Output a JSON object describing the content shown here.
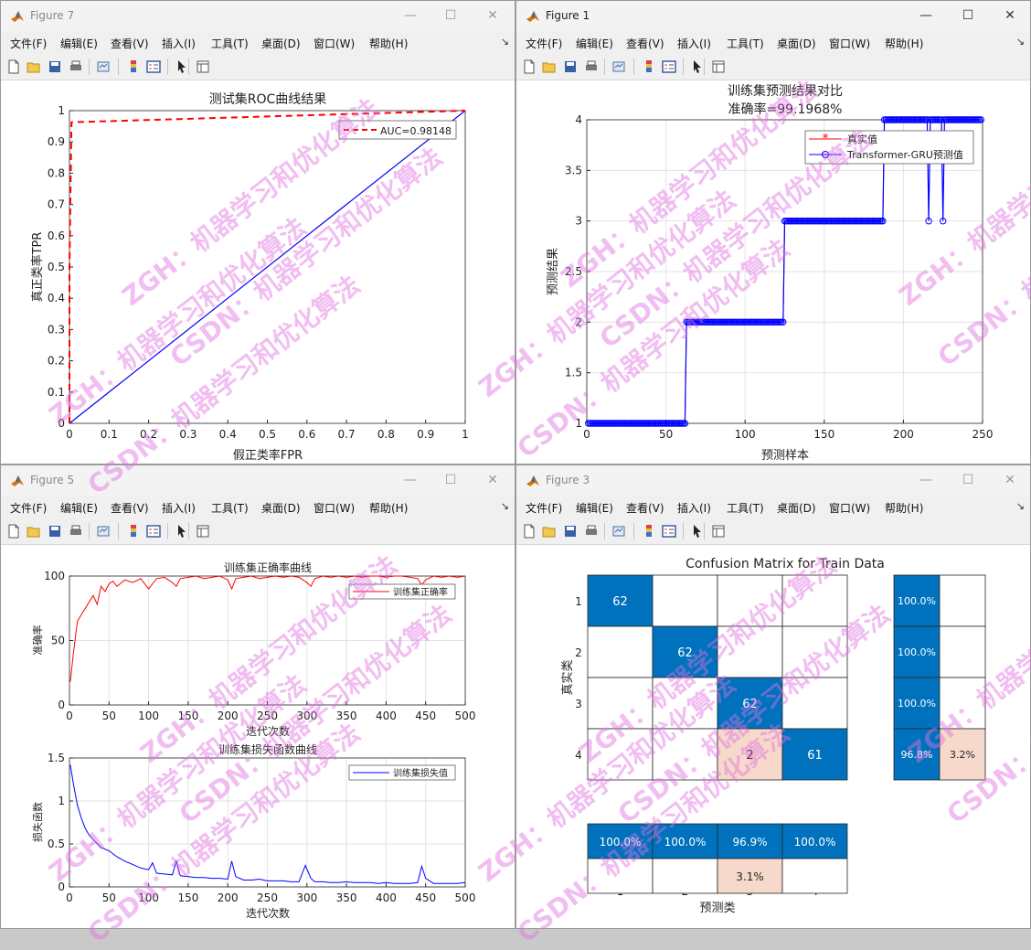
{
  "colors": {
    "red": "#ff0000",
    "blue": "#0000ff",
    "matrix_blue": "#0072bd",
    "matrix_peach": "#f6d9ca"
  },
  "menus": [
    "文件(F)",
    "编辑(E)",
    "查看(V)",
    "插入(I)",
    "工具(T)",
    "桌面(D)",
    "窗口(W)",
    "帮助(H)"
  ],
  "toolbar_icons": [
    "new-file-icon",
    "open-folder-icon",
    "save-icon",
    "print-icon",
    "link-icon",
    "colorbar-icon",
    "legend-icon",
    "pointer-icon",
    "property-inspector-icon"
  ],
  "watermarks": [
    "ZGH：机器学习和优化算法",
    "CSDN：机器学习和优化算法"
  ],
  "windows": {
    "fig7": {
      "title": "Figure 7"
    },
    "fig1": {
      "title": "Figure 1"
    },
    "fig5": {
      "title": "Figure 5"
    },
    "fig3": {
      "title": "Figure 3"
    }
  },
  "roc": {
    "title": "测试集ROC曲线结果",
    "xlabel": "假正类率FPR",
    "ylabel": "真正类率TPR",
    "legend": "AUC=0.98148",
    "xticks": [
      "0",
      "0.1",
      "0.2",
      "0.3",
      "0.4",
      "0.5",
      "0.6",
      "0.7",
      "0.8",
      "0.9",
      "1"
    ],
    "yticks": [
      "0",
      "0.1",
      "0.2",
      "0.3",
      "0.4",
      "0.5",
      "0.6",
      "0.7",
      "0.8",
      "0.9",
      "1"
    ]
  },
  "pred": {
    "title1": "训练集预测结果对比",
    "title2": "准确率=99.1968%",
    "xlabel": "预测样本",
    "ylabel": "预测结果",
    "legend_true": "真实值",
    "legend_pred": "Transformer-GRU预测值",
    "xticks": [
      "0",
      "50",
      "100",
      "150",
      "200",
      "250"
    ],
    "yticks": [
      "1",
      "1.5",
      "2",
      "2.5",
      "3",
      "3.5",
      "4"
    ]
  },
  "acc": {
    "title": "训练集正确率曲线",
    "xlabel": "迭代次数",
    "ylabel": "准确率",
    "legend": "训练集正确率",
    "xticks": [
      "0",
      "50",
      "100",
      "150",
      "200",
      "250",
      "300",
      "350",
      "400",
      "450",
      "500"
    ],
    "yticks": [
      "0",
      "50",
      "100"
    ]
  },
  "loss": {
    "title": "训练集损失函数曲线",
    "xlabel": "迭代次数",
    "ylabel": "损失函数",
    "legend": "训练集损失值",
    "xticks": [
      "0",
      "50",
      "100",
      "150",
      "200",
      "250",
      "300",
      "350",
      "400",
      "450",
      "500"
    ],
    "yticks": [
      "0",
      "0.5",
      "1",
      "1.5"
    ]
  },
  "cm": {
    "title": "Confusion Matrix for Train Data",
    "xlabel": "预测类",
    "ylabel": "真实类",
    "class_labels": [
      "1",
      "2",
      "3",
      "4"
    ],
    "row_summary": [
      [
        "100.0%",
        ""
      ],
      [
        "100.0%",
        ""
      ],
      [
        "100.0%",
        ""
      ],
      [
        "96.8%",
        "3.2%"
      ]
    ],
    "col_summary": [
      [
        "100.0%",
        ""
      ],
      [
        "100.0%",
        ""
      ],
      [
        "96.9%",
        "3.1%"
      ],
      [
        "100.0%",
        ""
      ]
    ]
  },
  "chart_data": [
    {
      "type": "line",
      "title": "测试集ROC曲线结果",
      "xlabel": "假正类率FPR",
      "ylabel": "真正类率TPR",
      "xlim": [
        0,
        1
      ],
      "ylim": [
        0,
        1
      ],
      "grid": false,
      "legend_position": "top-right",
      "series": [
        {
          "name": "AUC=0.98148",
          "style": "dashed",
          "color": "#ff0000",
          "x": [
            0,
            0,
            0.005,
            1
          ],
          "y": [
            0,
            0.5,
            0.963,
            1
          ]
        },
        {
          "style": "solid",
          "color": "#0000ff",
          "x": [
            0,
            1
          ],
          "y": [
            0,
            1
          ]
        }
      ]
    },
    {
      "type": "line",
      "title": "训练集预测结果对比 准确率=99.1968%",
      "xlabel": "预测样本",
      "ylabel": "预测结果",
      "xlim": [
        0,
        250
      ],
      "ylim": [
        1,
        4
      ],
      "grid": true,
      "legend_position": "top-right",
      "segments": [
        {
          "from": 1,
          "to": 62,
          "value": 1
        },
        {
          "from": 63,
          "to": 124,
          "value": 2
        },
        {
          "from": 125,
          "to": 187,
          "value": 3
        },
        {
          "from": 188,
          "to": 249,
          "value": 4
        }
      ],
      "pred_errors": [
        {
          "x": 216,
          "y": 3
        },
        {
          "x": 225,
          "y": 3
        }
      ],
      "series": [
        {
          "name": "真实值",
          "color": "#ff0000",
          "marker": "*"
        },
        {
          "name": "Transformer-GRU预测值",
          "color": "#0000ff",
          "marker": "o"
        }
      ]
    },
    {
      "type": "line",
      "title": "训练集正确率曲线",
      "xlabel": "迭代次数",
      "ylabel": "准确率",
      "xlim": [
        0,
        500
      ],
      "ylim": [
        0,
        100
      ],
      "grid": true,
      "legend_position": "top-right",
      "series": [
        {
          "name": "训练集正确率",
          "color": "#ff0000",
          "x": [
            1,
            5,
            10,
            15,
            20,
            25,
            30,
            35,
            40,
            45,
            50,
            55,
            60,
            70,
            80,
            90,
            100,
            110,
            120,
            130,
            135,
            140,
            150,
            160,
            170,
            180,
            190,
            200,
            205,
            210,
            220,
            230,
            240,
            250,
            260,
            270,
            280,
            290,
            300,
            305,
            310,
            320,
            330,
            340,
            350,
            360,
            370,
            380,
            390,
            400,
            410,
            420,
            430,
            440,
            445,
            450,
            460,
            470,
            480,
            490,
            500
          ],
          "y": [
            18,
            40,
            65,
            70,
            75,
            80,
            85,
            78,
            92,
            88,
            94,
            96,
            92,
            97,
            95,
            98,
            90,
            98,
            99,
            95,
            92,
            98,
            99,
            100,
            98,
            99,
            100,
            97,
            90,
            98,
            99,
            100,
            98,
            99,
            100,
            99,
            100,
            99,
            95,
            92,
            98,
            100,
            99,
            100,
            99,
            100,
            99,
            100,
            100,
            99,
            100,
            100,
            99,
            98,
            93,
            97,
            100,
            99,
            100,
            99,
            100
          ]
        }
      ]
    },
    {
      "type": "line",
      "title": "训练集损失函数曲线",
      "xlabel": "迭代次数",
      "ylabel": "损失函数",
      "xlim": [
        0,
        500
      ],
      "ylim": [
        0,
        1.5
      ],
      "grid": true,
      "legend_position": "top-right",
      "series": [
        {
          "name": "训练集损失值",
          "color": "#0000ff",
          "x": [
            1,
            5,
            10,
            15,
            20,
            25,
            30,
            40,
            50,
            60,
            70,
            80,
            90,
            100,
            105,
            110,
            120,
            130,
            135,
            140,
            150,
            160,
            170,
            180,
            190,
            200,
            205,
            210,
            220,
            230,
            240,
            250,
            260,
            270,
            280,
            290,
            298,
            305,
            310,
            320,
            330,
            340,
            350,
            360,
            370,
            380,
            390,
            400,
            410,
            420,
            430,
            440,
            445,
            450,
            460,
            470,
            480,
            490,
            500
          ],
          "y": [
            1.42,
            1.2,
            0.95,
            0.8,
            0.68,
            0.6,
            0.55,
            0.46,
            0.42,
            0.35,
            0.3,
            0.26,
            0.22,
            0.2,
            0.28,
            0.16,
            0.15,
            0.14,
            0.3,
            0.13,
            0.12,
            0.11,
            0.11,
            0.1,
            0.1,
            0.09,
            0.3,
            0.12,
            0.08,
            0.08,
            0.09,
            0.07,
            0.07,
            0.07,
            0.06,
            0.06,
            0.25,
            0.1,
            0.06,
            0.06,
            0.05,
            0.05,
            0.06,
            0.05,
            0.05,
            0.05,
            0.04,
            0.05,
            0.04,
            0.04,
            0.04,
            0.05,
            0.24,
            0.1,
            0.04,
            0.04,
            0.04,
            0.04,
            0.05
          ]
        }
      ]
    },
    {
      "type": "heatmap",
      "title": "Confusion Matrix for Train Data",
      "xlabel": "预测类",
      "ylabel": "真实类",
      "categories": [
        "1",
        "2",
        "3",
        "4"
      ],
      "matrix": [
        [
          62,
          0,
          0,
          0
        ],
        [
          0,
          62,
          0,
          0
        ],
        [
          0,
          0,
          62,
          0
        ],
        [
          0,
          0,
          2,
          61
        ]
      ]
    }
  ]
}
